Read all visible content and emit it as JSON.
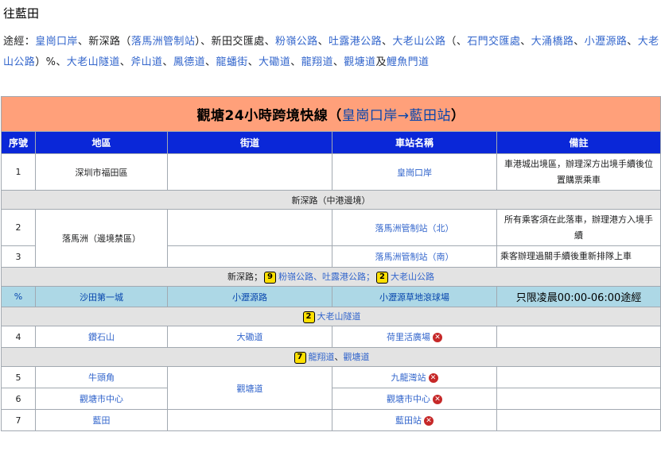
{
  "heading": "往藍田",
  "via": {
    "label": "途經：",
    "parts": [
      {
        "text": "皇崗口岸",
        "link": true
      },
      {
        "text": "、",
        "link": false
      },
      {
        "text": "新深路",
        "link": false
      },
      {
        "text": "（",
        "link": false
      },
      {
        "text": "落馬洲管制站",
        "link": true
      },
      {
        "text": "）、",
        "link": false
      },
      {
        "text": "新田交匯處",
        "link": false
      },
      {
        "text": "、",
        "link": false
      },
      {
        "text": "粉嶺公路",
        "link": true
      },
      {
        "text": "、",
        "link": false
      },
      {
        "text": "吐露港公路",
        "link": true
      },
      {
        "text": "、",
        "link": false
      },
      {
        "text": "大老山公路",
        "link": true
      },
      {
        "text": "（、",
        "link": false
      },
      {
        "text": "石門交匯處",
        "link": true
      },
      {
        "text": "、",
        "link": false
      },
      {
        "text": "大涌橋路",
        "link": true
      },
      {
        "text": "、",
        "link": false
      },
      {
        "text": "小瀝源路",
        "link": true
      },
      {
        "text": "、",
        "link": false
      },
      {
        "text": "大老山公路",
        "link": true
      },
      {
        "text": "）",
        "link": false
      },
      {
        "text": "%",
        "link": false
      },
      {
        "text": "、",
        "link": false
      },
      {
        "text": "大老山隧道",
        "link": true
      },
      {
        "text": "、",
        "link": false
      },
      {
        "text": "斧山道",
        "link": true
      },
      {
        "text": "、",
        "link": false
      },
      {
        "text": "鳳德道",
        "link": true
      },
      {
        "text": "、",
        "link": false
      },
      {
        "text": "龍蟠街",
        "link": true
      },
      {
        "text": "、",
        "link": false
      },
      {
        "text": "大磡道",
        "link": true
      },
      {
        "text": "、",
        "link": false
      },
      {
        "text": "龍翔道",
        "link": true
      },
      {
        "text": "、",
        "link": false
      },
      {
        "text": "觀塘道",
        "link": true
      },
      {
        "text": "及",
        "link": false
      },
      {
        "text": "鯉魚門道",
        "link": true
      }
    ]
  },
  "table": {
    "title_prefix": "觀塘24小時跨境快線（",
    "title_route": "皇崗口岸→藍田站",
    "title_suffix": "）",
    "headers": [
      "序號",
      "地區",
      "街道",
      "車站名稱",
      "備註"
    ],
    "row1": {
      "num": "1",
      "district": "深圳市福田區",
      "street": "",
      "stop": "皇崗口岸",
      "note": "車港城出境區，辦理深方出境手續後位置購票乘車"
    },
    "sep1": "新深路（中港邊境）",
    "row2": {
      "num": "2",
      "district": "落馬洲（邊境禁區）",
      "street": "",
      "stop": "落馬洲管制站（北）",
      "note": "所有乘客須在此落車，辦理港方入境手續"
    },
    "row3": {
      "num": "3",
      "street": "",
      "stop": "落馬洲管制站（南）",
      "note": "乘客辦理過關手續後重新排隊上車"
    },
    "sep2": {
      "pre": "新深路；",
      "badge_a": "9",
      "roads_a": "粉嶺公路、吐露港公路；",
      "badge_b": "2",
      "roads_b": "大老山公路"
    },
    "row_pct": {
      "num": "%",
      "district": "沙田第一城",
      "street": "小瀝源路",
      "stop": "小瀝源草地滾球場",
      "note": "只限凌晨00:00-06:00途經"
    },
    "sep3": {
      "badge": "2",
      "road": "大老山隧道"
    },
    "row4": {
      "num": "4",
      "district": "鑽石山",
      "street": "大磡道",
      "stop": "荷里活廣場",
      "note": ""
    },
    "sep4": {
      "badge": "7",
      "road": "龍翔道",
      "mid": "、",
      "road2": "觀塘道"
    },
    "row5": {
      "num": "5",
      "district": "牛頭角",
      "street": "觀塘道",
      "stop": "九龍灣站",
      "note": ""
    },
    "row6": {
      "num": "6",
      "district": "觀塘市中心",
      "stop": "觀塘市中心",
      "note": ""
    },
    "row7": {
      "num": "7",
      "district": "藍田",
      "stop": "藍田站",
      "note": ""
    },
    "closed_icon_glyph": "✕"
  },
  "colors": {
    "title_bg": "#ffa07a",
    "header_bg": "#0a27d8",
    "highlight_bg": "#add8e6",
    "separator_bg": "#e3e3e3",
    "link": "#3366cc",
    "badge_bg": "#ffe000"
  }
}
